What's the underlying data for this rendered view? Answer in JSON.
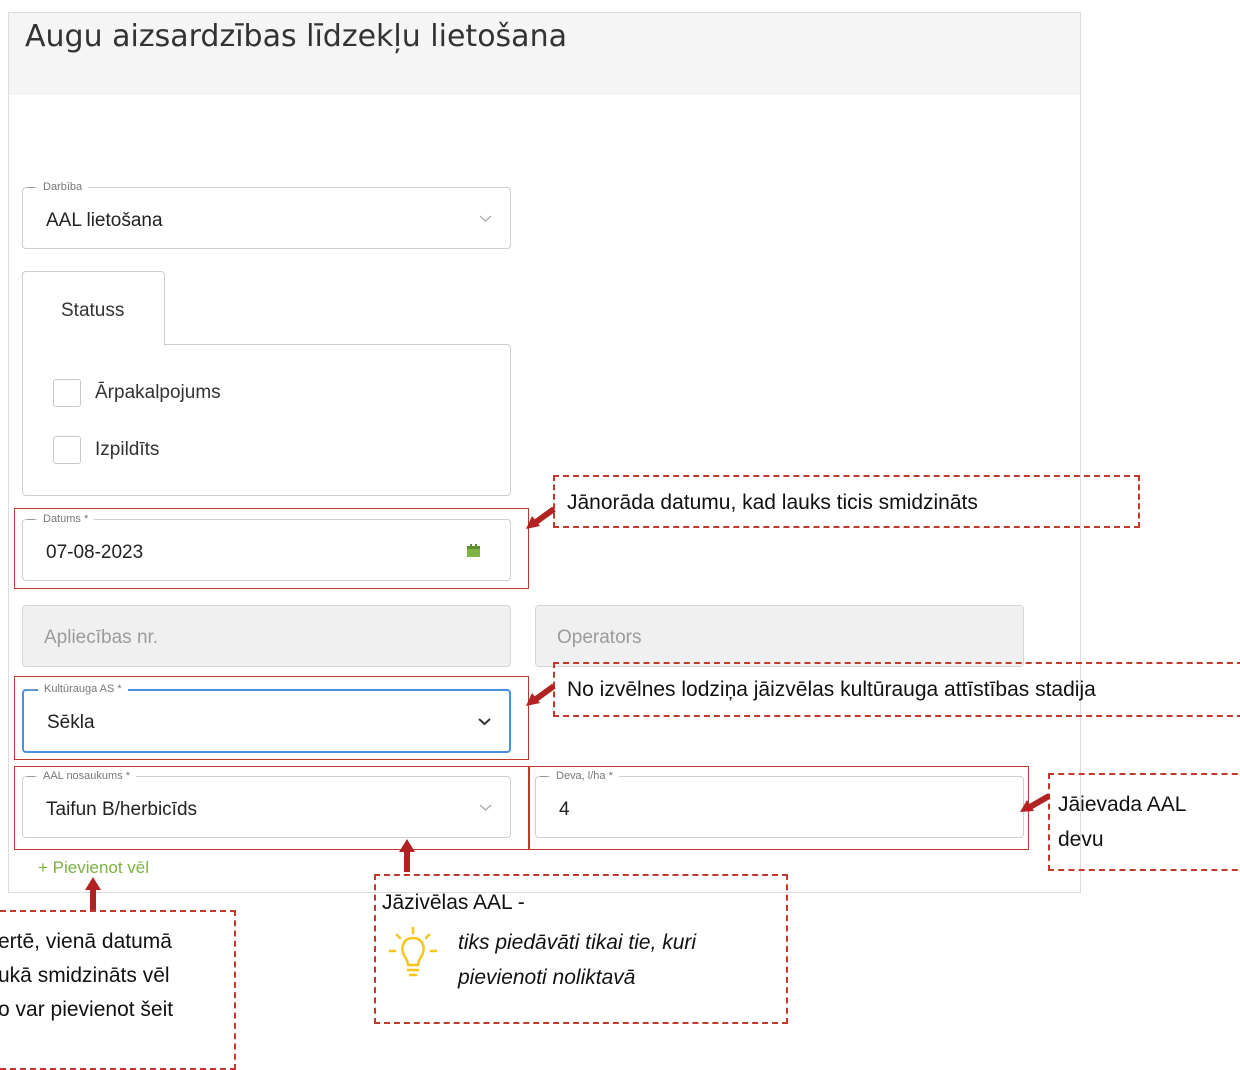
{
  "page": {
    "title": "Augu aizsardzības līdzekļu lietošana"
  },
  "form": {
    "darbiba": {
      "legend": "Darbība",
      "value": "AAL lietošana"
    },
    "tab": {
      "label": "Statuss"
    },
    "checkboxes": [
      {
        "label": "Ārpakalpojums",
        "checked": false
      },
      {
        "label": "Izpildīts",
        "checked": false
      }
    ],
    "datums": {
      "legend": "Datums *",
      "value": "07-08-2023"
    },
    "apliecibas": {
      "placeholder": "Apliecības nr."
    },
    "operators": {
      "placeholder": "Operators"
    },
    "kulturauga": {
      "legend": "Kultūrauga AS *",
      "value": "Sēkla"
    },
    "aal": {
      "legend": "AAL nosaukums *",
      "value": "Taifun B/herbicīds"
    },
    "deva": {
      "legend": "Deva, l/ha *",
      "value": "4"
    },
    "add_more": "+ Pievienot vēl"
  },
  "callouts": {
    "datums": "Jānorāda datumu, kad lauks ticis smidzināts",
    "kulturauga": "No izvēlnes lodziņa jāizvēlas kultūrauga attīstības stadija",
    "deva_line1": "Jāievada AAL",
    "deva_line2": "devu",
    "aal_line1": "Jāzivēlas  AAL -",
    "aal_line2": "tiks piedāvāti tikai tie, kuri",
    "aal_line3": "pievienoti noliktavā",
    "add_line1": "ertē, vienā datumā",
    "add_line2": "ukā smidzināts vēl",
    "add_line3": "o var pievienot šeit"
  },
  "colors": {
    "accent_green": "#7cb342",
    "annotation_red": "#c0392b",
    "focus_blue": "#4a90e2",
    "bulb_yellow": "#f5c518"
  },
  "icons": {
    "datums": "calendar-icon",
    "select": "chevron-down-icon",
    "tip": "lightbulb-icon"
  }
}
